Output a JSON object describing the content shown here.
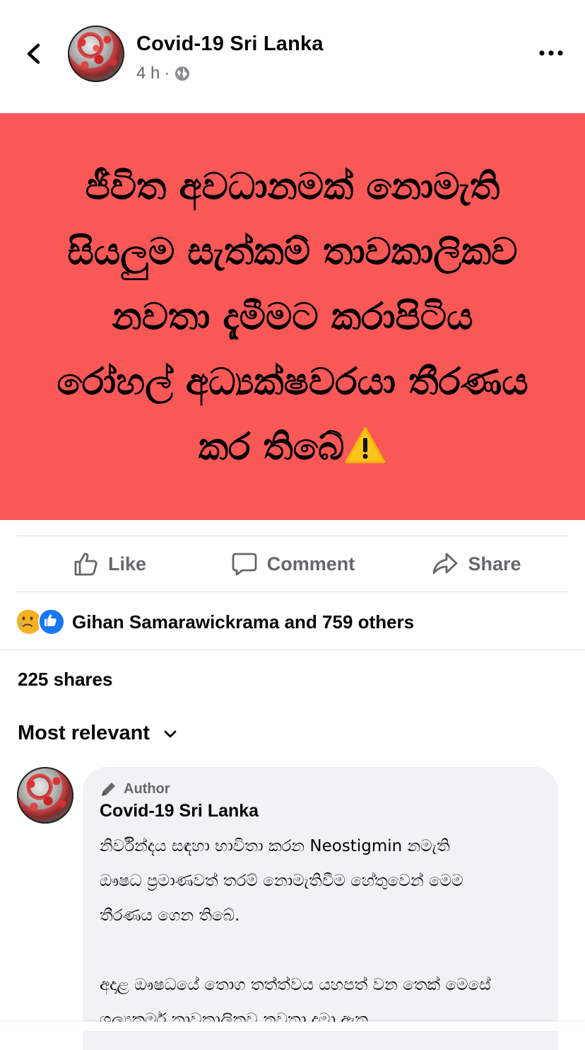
{
  "header": {
    "page_name": "Covid-19 Sri Lanka",
    "time": "4 h",
    "separator": "·",
    "privacy_icon": "globe-icon",
    "back_icon": "chevron-left-icon",
    "more_icon": "more-horizontal-icon"
  },
  "post": {
    "background_color": "#fa5757",
    "lines": [
      "ජීවිත අවධානමක් නොමැති",
      "සියලුම සැත්කම් තාවකාලිකව",
      "නවතා දැමීමට කරාපිටිය",
      "රෝහල් අධ්‍යක්ෂවරයා තීරණය",
      "කර තිබේ"
    ],
    "emoji": "warning-icon"
  },
  "actions": {
    "like": "Like",
    "comment": "Comment",
    "share": "Share"
  },
  "reactions": {
    "icons": [
      "sad-reaction-icon",
      "like-reaction-icon"
    ],
    "text": "Gihan Samarawickrama and 759 others"
  },
  "shares": "225 shares",
  "sort": {
    "label": "Most relevant"
  },
  "comment": {
    "badge": "Author",
    "name": "Covid-19 Sri Lanka",
    "paragraphs": [
      [
        "නිර්වින්දය සඳහා භාවිතා කරන Neostigmin නමැති",
        "ඖෂධ ප්‍රමාණවත් තරම් නොමැතිවීම හේතුවෙන් මෙම",
        "තීරණය ගෙන තිබේ."
      ],
      [
        "අදාළ ඖෂධයේ තොග තත්ත්වය යහපත් වන තෙක් මෙසේ",
        "ශල්‍යකර්ම තාවකාලිකව නවතා දමා ඇත."
      ]
    ]
  }
}
